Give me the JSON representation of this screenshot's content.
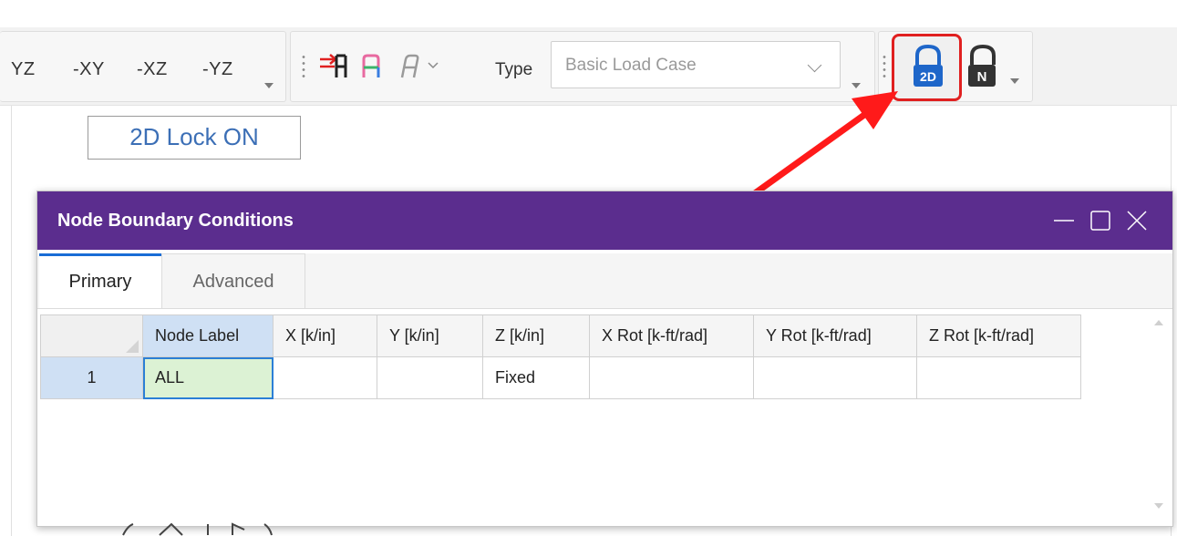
{
  "toolbar": {
    "view_buttons": [
      "YZ",
      "-XY",
      "-XZ",
      "-YZ"
    ],
    "type_label": "Type",
    "type_select_value": "Basic Load Case",
    "lock_2d_icon": "lock-2d-icon",
    "lock_n_icon": "lock-n-icon",
    "lock_2d_badge": "2D",
    "lock_n_badge": "N",
    "highlight_color": "#e02020"
  },
  "canvas": {
    "lock_status": "2D Lock ON"
  },
  "dialog": {
    "title": "Node Boundary Conditions",
    "title_bar_color": "#5b2d8e",
    "tabs": [
      "Primary",
      "Advanced"
    ],
    "active_tab": "Primary",
    "table": {
      "columns": [
        "Node Label",
        "X [k/in]",
        "Y [k/in]",
        "Z [k/in]",
        "X Rot [k-ft/rad]",
        "Y Rot [k-ft/rad]",
        "Z Rot [k-ft/rad]"
      ],
      "rows": [
        {
          "num": "1",
          "cells": [
            "ALL",
            "",
            "",
            "Fixed",
            "",
            "",
            ""
          ]
        }
      ]
    }
  }
}
